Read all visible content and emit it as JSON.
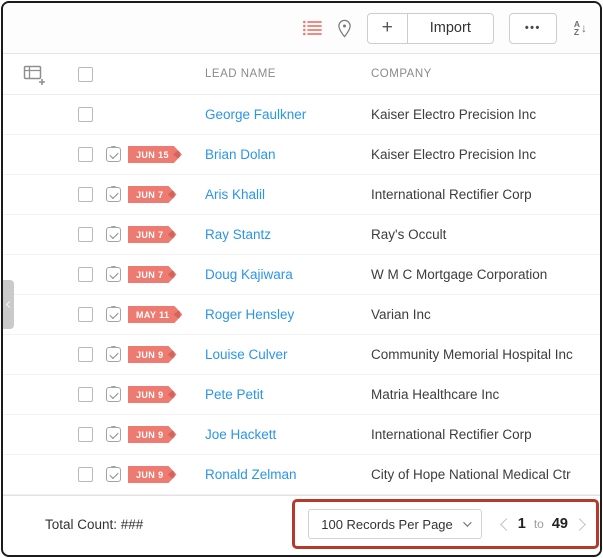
{
  "toolbar": {
    "plus_label": "+",
    "import_label": "Import",
    "more_label": "•••",
    "sort_top": "A",
    "sort_bottom": "Z",
    "sort_arrow": "↓"
  },
  "table": {
    "columns": [
      "LEAD NAME",
      "COMPANY"
    ]
  },
  "rows": [
    {
      "name": "George Faulkner",
      "company": "Kaiser Electro Precision Inc",
      "due": ""
    },
    {
      "name": "Brian Dolan",
      "company": "Kaiser Electro Precision Inc",
      "due": "JUN 15"
    },
    {
      "name": "Aris Khalil",
      "company": "International Rectifier Corp",
      "due": "JUN 7"
    },
    {
      "name": "Ray Stantz",
      "company": "Ray's Occult",
      "due": "JUN 7"
    },
    {
      "name": "Doug Kajiwara",
      "company": "W M C Mortgage Corporation",
      "due": "JUN 7"
    },
    {
      "name": "Roger Hensley",
      "company": "Varian Inc",
      "due": "MAY 11"
    },
    {
      "name": "Louise Culver",
      "company": "Community Memorial Hospital Inc",
      "due": "JUN 9"
    },
    {
      "name": "Pete Petit",
      "company": "Matria Healthcare Inc",
      "due": "JUN 9"
    },
    {
      "name": "Joe Hackett",
      "company": "International Rectifier Corp",
      "due": "JUN 9"
    },
    {
      "name": "Ronald Zelman",
      "company": "City of Hope National Medical Ctr",
      "due": "JUN 9"
    }
  ],
  "footer": {
    "total_label": "Total Count: ###",
    "records_per_page": "100 Records Per Page",
    "page_start": "1",
    "page_to": "to",
    "page_end": "49"
  },
  "colors": {
    "accent_coral": "#ee7b71",
    "link_blue": "#2b95e9",
    "annotation_red": "#b6392c"
  }
}
